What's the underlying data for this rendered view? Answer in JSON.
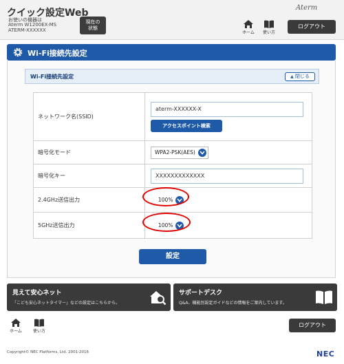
{
  "header": {
    "title": "クイック設定Web",
    "device_label": "お使いの機器は",
    "device_model": "Aterm W1200EX-MS",
    "device_name": "ATERM-XXXXXX",
    "status_button": "現在の\n状態",
    "logo": "Aterm",
    "home_label": "ホーム",
    "help_label": "使い方",
    "logout_label": "ログアウト"
  },
  "page": {
    "banner_title": "Wi-Fi接続先設定",
    "section_title": "Wi-Fi接続先設定",
    "close_label": "閉じる"
  },
  "form": {
    "ssid": {
      "label": "ネットワーク名(SSID)",
      "value": "aterm-XXXXXX-X",
      "search_button": "アクセスポイント検索"
    },
    "encryption_mode": {
      "label": "暗号化モード",
      "value": "WPA2-PSK(AES)"
    },
    "encryption_key": {
      "label": "暗号化キー",
      "value": "XXXXXXXXXXXXX"
    },
    "power_24": {
      "label": "2.4GHz送信出力",
      "value": "100%"
    },
    "power_5": {
      "label": "5GHz送信出力",
      "value": "100%"
    },
    "submit_label": "設定"
  },
  "cards": {
    "safety": {
      "title": "見えて安心ネット",
      "desc": "「こども安心ネットタイマー」などの設定はこちらから。"
    },
    "support": {
      "title": "サポートデスク",
      "desc": "Q&A、機能別設定ガイドなどの情報をご案内しています。"
    }
  },
  "footer": {
    "home_label": "ホーム",
    "help_label": "使い方",
    "logout_label": "ログアウト",
    "copyright": "Copyright© NEC Platforms, Ltd. 2001-2016",
    "brand": "NEC"
  },
  "colors": {
    "accent": "#1f5aa8",
    "dark": "#3a3a3a",
    "highlight": "#e00000"
  }
}
